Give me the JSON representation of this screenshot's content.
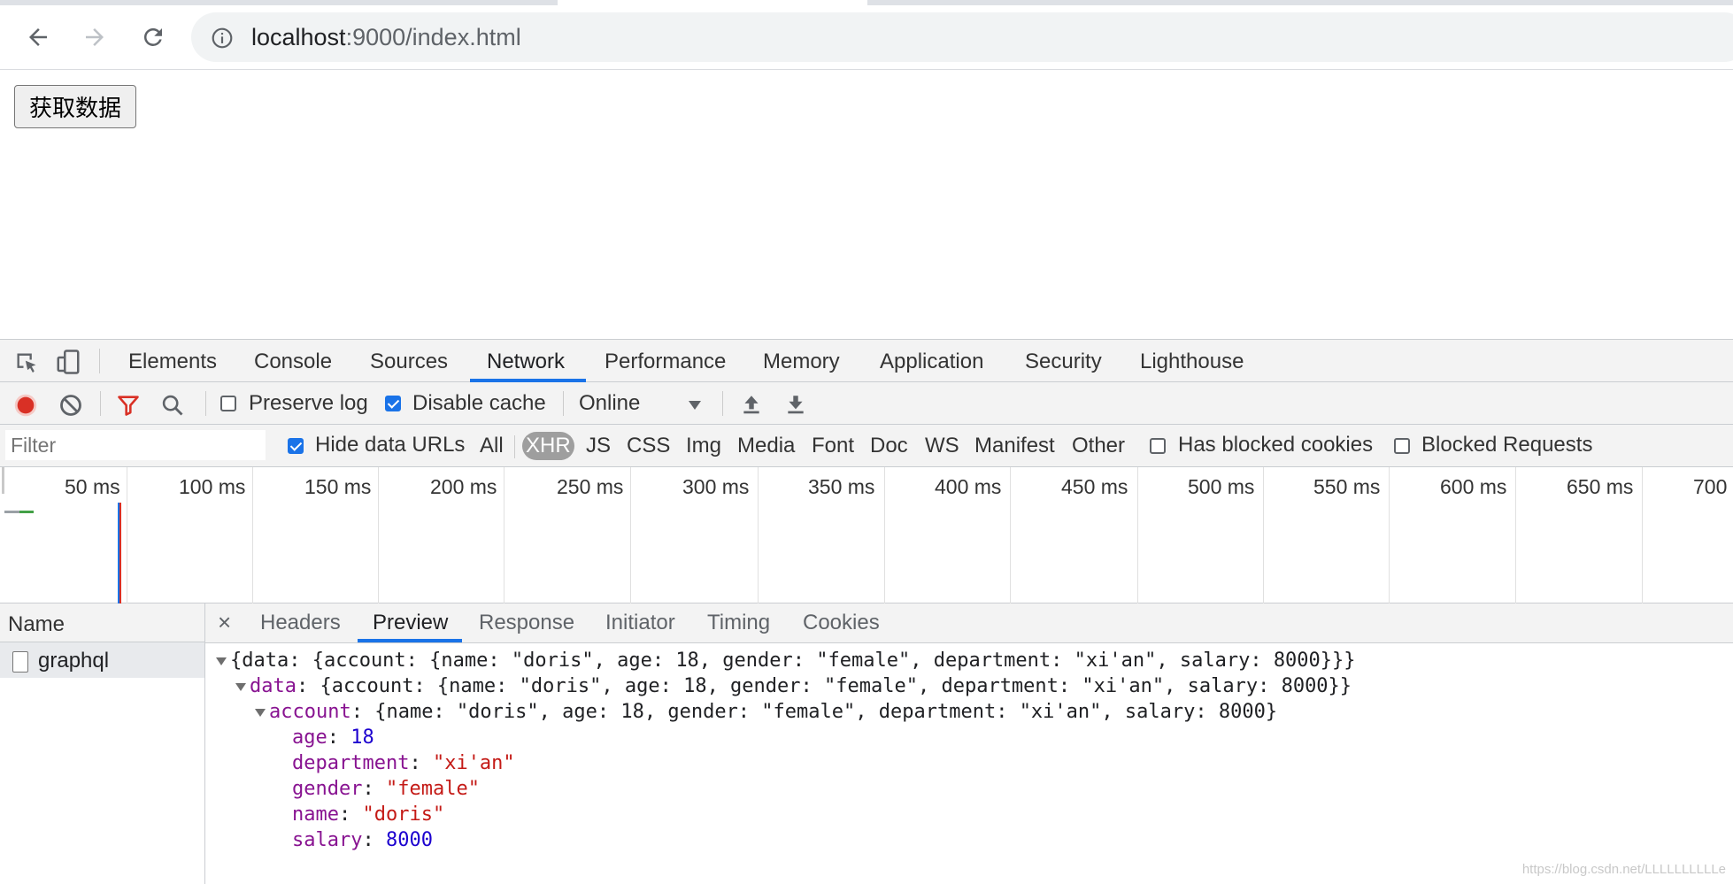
{
  "browser": {
    "url_host": "localhost",
    "url_rest": ":9000/index.html",
    "icons": [
      "back-arrow",
      "forward-arrow",
      "reload",
      "info-circle"
    ]
  },
  "page": {
    "fetch_button": "获取数据"
  },
  "devtools": {
    "tabs": [
      "Elements",
      "Console",
      "Sources",
      "Network",
      "Performance",
      "Memory",
      "Application",
      "Security",
      "Lighthouse"
    ],
    "active_tab": "Network",
    "network_toolbar": {
      "preserve_log": "Preserve log",
      "preserve_log_checked": false,
      "disable_cache": "Disable cache",
      "disable_cache_checked": true,
      "throttle": "Online"
    },
    "filter_bar": {
      "filter_placeholder": "Filter",
      "hide_data_urls": "Hide data URLs",
      "hide_data_urls_checked": true,
      "types": [
        "All",
        "XHR",
        "JS",
        "CSS",
        "Img",
        "Media",
        "Font",
        "Doc",
        "WS",
        "Manifest",
        "Other"
      ],
      "active_type": "XHR",
      "has_blocked_cookies": "Has blocked cookies",
      "blocked_requests": "Blocked Requests"
    },
    "timeline_ticks": [
      "50 ms",
      "100 ms",
      "150 ms",
      "200 ms",
      "250 ms",
      "300 ms",
      "350 ms",
      "400 ms",
      "450 ms",
      "500 ms",
      "550 ms",
      "600 ms",
      "650 ms",
      "700"
    ],
    "requests": {
      "header": "Name",
      "items": [
        "graphql"
      ]
    },
    "detail": {
      "close": "×",
      "tabs": [
        "Headers",
        "Preview",
        "Response",
        "Initiator",
        "Timing",
        "Cookies"
      ],
      "active_tab": "Preview"
    },
    "preview": {
      "root_summary": "{data: {account: {name: \"doris\", age: 18, gender: \"female\", department: \"xi'an\", salary: 8000}}}",
      "data_key": "data",
      "data_summary": ": {account: {name: \"doris\", age: 18, gender: \"female\", department: \"xi'an\", salary: 8000}}",
      "account_key": "account",
      "account_summary": ": {name: \"doris\", age: 18, gender: \"female\", department: \"xi'an\", salary: 8000}",
      "fields": [
        {
          "key": "age",
          "value": "18",
          "kind": "num"
        },
        {
          "key": "department",
          "value": "\"xi'an\"",
          "kind": "str"
        },
        {
          "key": "gender",
          "value": "\"female\"",
          "kind": "str"
        },
        {
          "key": "name",
          "value": "\"doris\"",
          "kind": "str"
        },
        {
          "key": "salary",
          "value": "8000",
          "kind": "num"
        }
      ]
    },
    "watermark": "https://blog.csdn.net/LLLLLLLLLLe"
  }
}
